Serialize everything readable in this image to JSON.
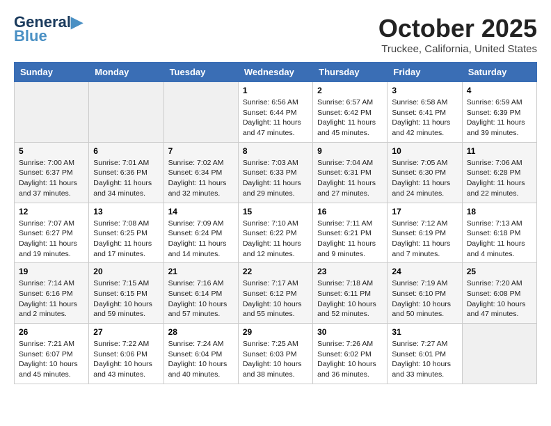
{
  "header": {
    "logo_line1": "General",
    "logo_line2": "Blue",
    "month": "October 2025",
    "location": "Truckee, California, United States"
  },
  "weekdays": [
    "Sunday",
    "Monday",
    "Tuesday",
    "Wednesday",
    "Thursday",
    "Friday",
    "Saturday"
  ],
  "weeks": [
    [
      {
        "day": "",
        "content": ""
      },
      {
        "day": "",
        "content": ""
      },
      {
        "day": "",
        "content": ""
      },
      {
        "day": "1",
        "content": "Sunrise: 6:56 AM\nSunset: 6:44 PM\nDaylight: 11 hours and 47 minutes."
      },
      {
        "day": "2",
        "content": "Sunrise: 6:57 AM\nSunset: 6:42 PM\nDaylight: 11 hours and 45 minutes."
      },
      {
        "day": "3",
        "content": "Sunrise: 6:58 AM\nSunset: 6:41 PM\nDaylight: 11 hours and 42 minutes."
      },
      {
        "day": "4",
        "content": "Sunrise: 6:59 AM\nSunset: 6:39 PM\nDaylight: 11 hours and 39 minutes."
      }
    ],
    [
      {
        "day": "5",
        "content": "Sunrise: 7:00 AM\nSunset: 6:37 PM\nDaylight: 11 hours and 37 minutes."
      },
      {
        "day": "6",
        "content": "Sunrise: 7:01 AM\nSunset: 6:36 PM\nDaylight: 11 hours and 34 minutes."
      },
      {
        "day": "7",
        "content": "Sunrise: 7:02 AM\nSunset: 6:34 PM\nDaylight: 11 hours and 32 minutes."
      },
      {
        "day": "8",
        "content": "Sunrise: 7:03 AM\nSunset: 6:33 PM\nDaylight: 11 hours and 29 minutes."
      },
      {
        "day": "9",
        "content": "Sunrise: 7:04 AM\nSunset: 6:31 PM\nDaylight: 11 hours and 27 minutes."
      },
      {
        "day": "10",
        "content": "Sunrise: 7:05 AM\nSunset: 6:30 PM\nDaylight: 11 hours and 24 minutes."
      },
      {
        "day": "11",
        "content": "Sunrise: 7:06 AM\nSunset: 6:28 PM\nDaylight: 11 hours and 22 minutes."
      }
    ],
    [
      {
        "day": "12",
        "content": "Sunrise: 7:07 AM\nSunset: 6:27 PM\nDaylight: 11 hours and 19 minutes."
      },
      {
        "day": "13",
        "content": "Sunrise: 7:08 AM\nSunset: 6:25 PM\nDaylight: 11 hours and 17 minutes."
      },
      {
        "day": "14",
        "content": "Sunrise: 7:09 AM\nSunset: 6:24 PM\nDaylight: 11 hours and 14 minutes."
      },
      {
        "day": "15",
        "content": "Sunrise: 7:10 AM\nSunset: 6:22 PM\nDaylight: 11 hours and 12 minutes."
      },
      {
        "day": "16",
        "content": "Sunrise: 7:11 AM\nSunset: 6:21 PM\nDaylight: 11 hours and 9 minutes."
      },
      {
        "day": "17",
        "content": "Sunrise: 7:12 AM\nSunset: 6:19 PM\nDaylight: 11 hours and 7 minutes."
      },
      {
        "day": "18",
        "content": "Sunrise: 7:13 AM\nSunset: 6:18 PM\nDaylight: 11 hours and 4 minutes."
      }
    ],
    [
      {
        "day": "19",
        "content": "Sunrise: 7:14 AM\nSunset: 6:16 PM\nDaylight: 11 hours and 2 minutes."
      },
      {
        "day": "20",
        "content": "Sunrise: 7:15 AM\nSunset: 6:15 PM\nDaylight: 10 hours and 59 minutes."
      },
      {
        "day": "21",
        "content": "Sunrise: 7:16 AM\nSunset: 6:14 PM\nDaylight: 10 hours and 57 minutes."
      },
      {
        "day": "22",
        "content": "Sunrise: 7:17 AM\nSunset: 6:12 PM\nDaylight: 10 hours and 55 minutes."
      },
      {
        "day": "23",
        "content": "Sunrise: 7:18 AM\nSunset: 6:11 PM\nDaylight: 10 hours and 52 minutes."
      },
      {
        "day": "24",
        "content": "Sunrise: 7:19 AM\nSunset: 6:10 PM\nDaylight: 10 hours and 50 minutes."
      },
      {
        "day": "25",
        "content": "Sunrise: 7:20 AM\nSunset: 6:08 PM\nDaylight: 10 hours and 47 minutes."
      }
    ],
    [
      {
        "day": "26",
        "content": "Sunrise: 7:21 AM\nSunset: 6:07 PM\nDaylight: 10 hours and 45 minutes."
      },
      {
        "day": "27",
        "content": "Sunrise: 7:22 AM\nSunset: 6:06 PM\nDaylight: 10 hours and 43 minutes."
      },
      {
        "day": "28",
        "content": "Sunrise: 7:24 AM\nSunset: 6:04 PM\nDaylight: 10 hours and 40 minutes."
      },
      {
        "day": "29",
        "content": "Sunrise: 7:25 AM\nSunset: 6:03 PM\nDaylight: 10 hours and 38 minutes."
      },
      {
        "day": "30",
        "content": "Sunrise: 7:26 AM\nSunset: 6:02 PM\nDaylight: 10 hours and 36 minutes."
      },
      {
        "day": "31",
        "content": "Sunrise: 7:27 AM\nSunset: 6:01 PM\nDaylight: 10 hours and 33 minutes."
      },
      {
        "day": "",
        "content": ""
      }
    ]
  ]
}
